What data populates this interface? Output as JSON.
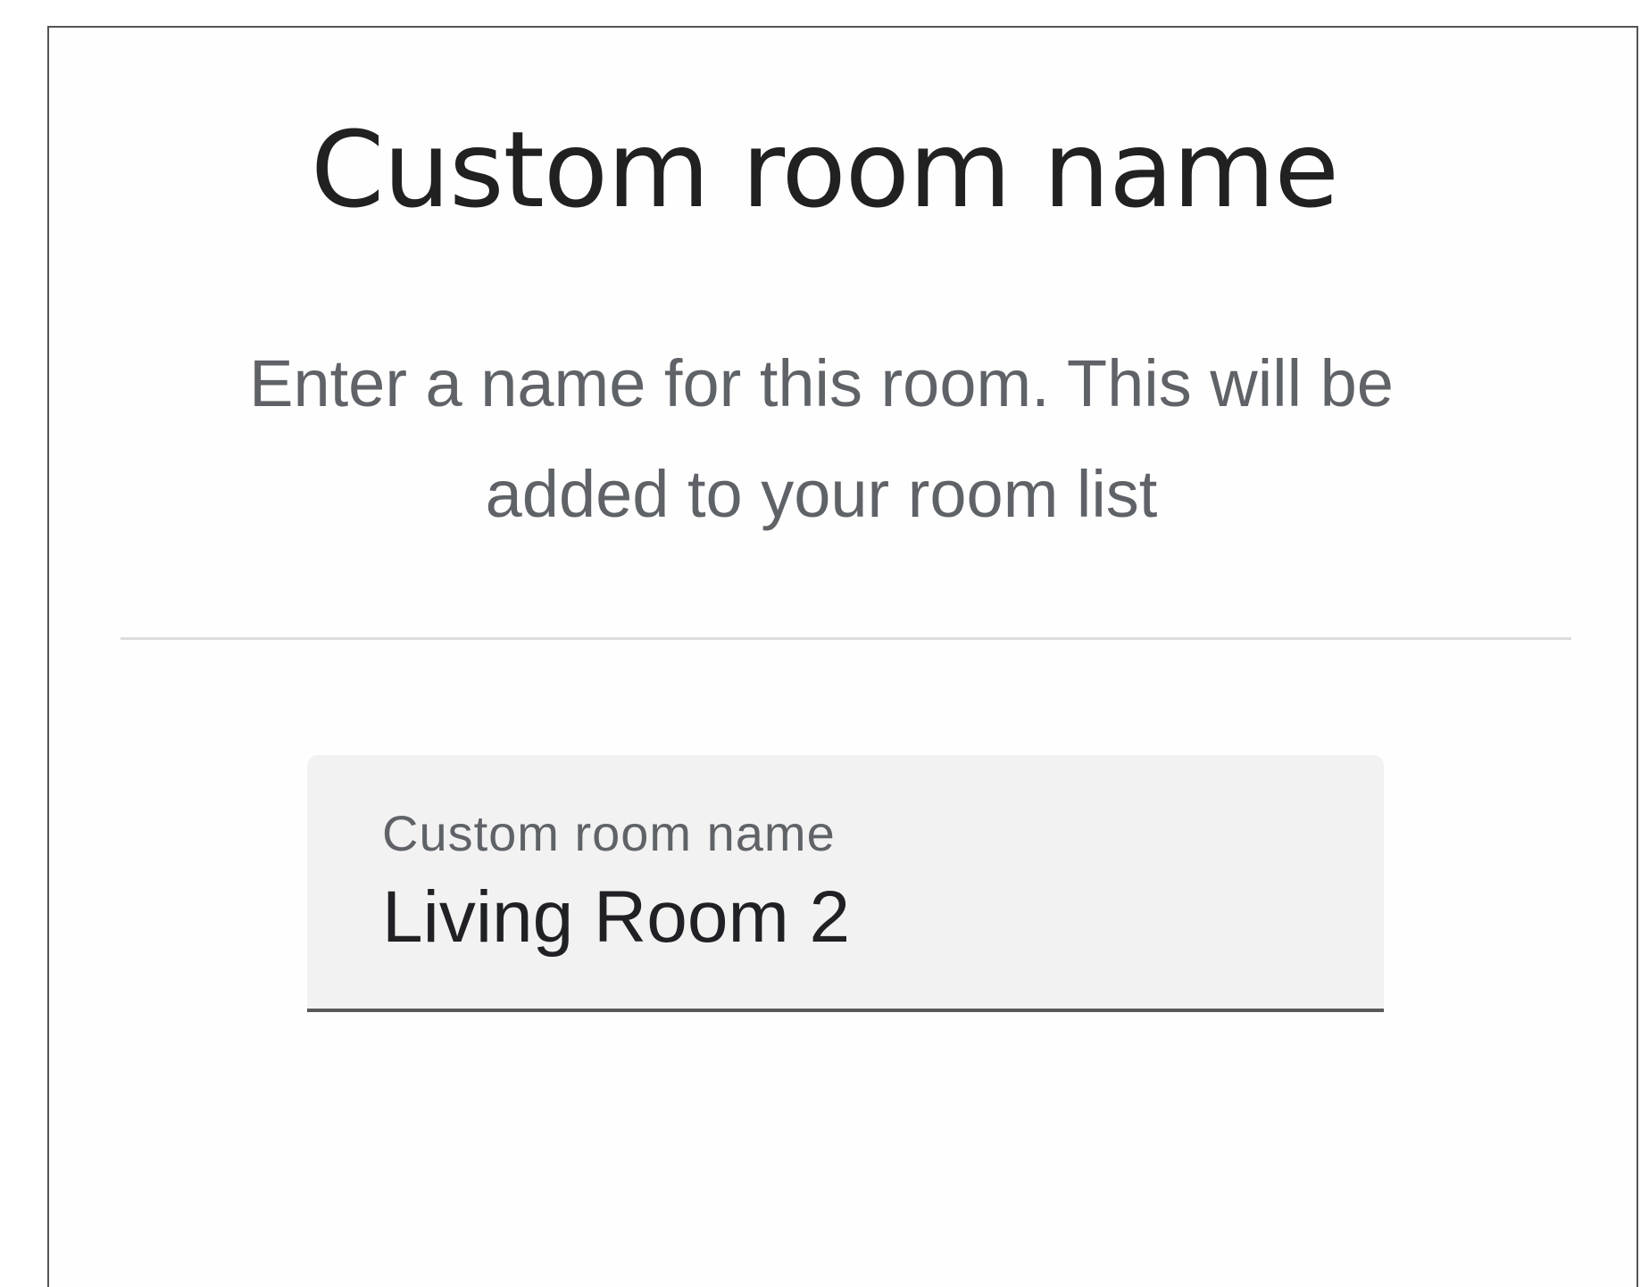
{
  "dialog": {
    "title": "Custom room name",
    "description": "Enter a name for this room. This will be added to your room list"
  },
  "room_name_field": {
    "label": "Custom room name",
    "value": "Living Room 2"
  },
  "colors": {
    "title_text": "#212121",
    "description_text": "#5f6368",
    "field_background": "#f3f2f2",
    "field_underline": "#5a5a5a",
    "divider": "#dcdcdc"
  }
}
